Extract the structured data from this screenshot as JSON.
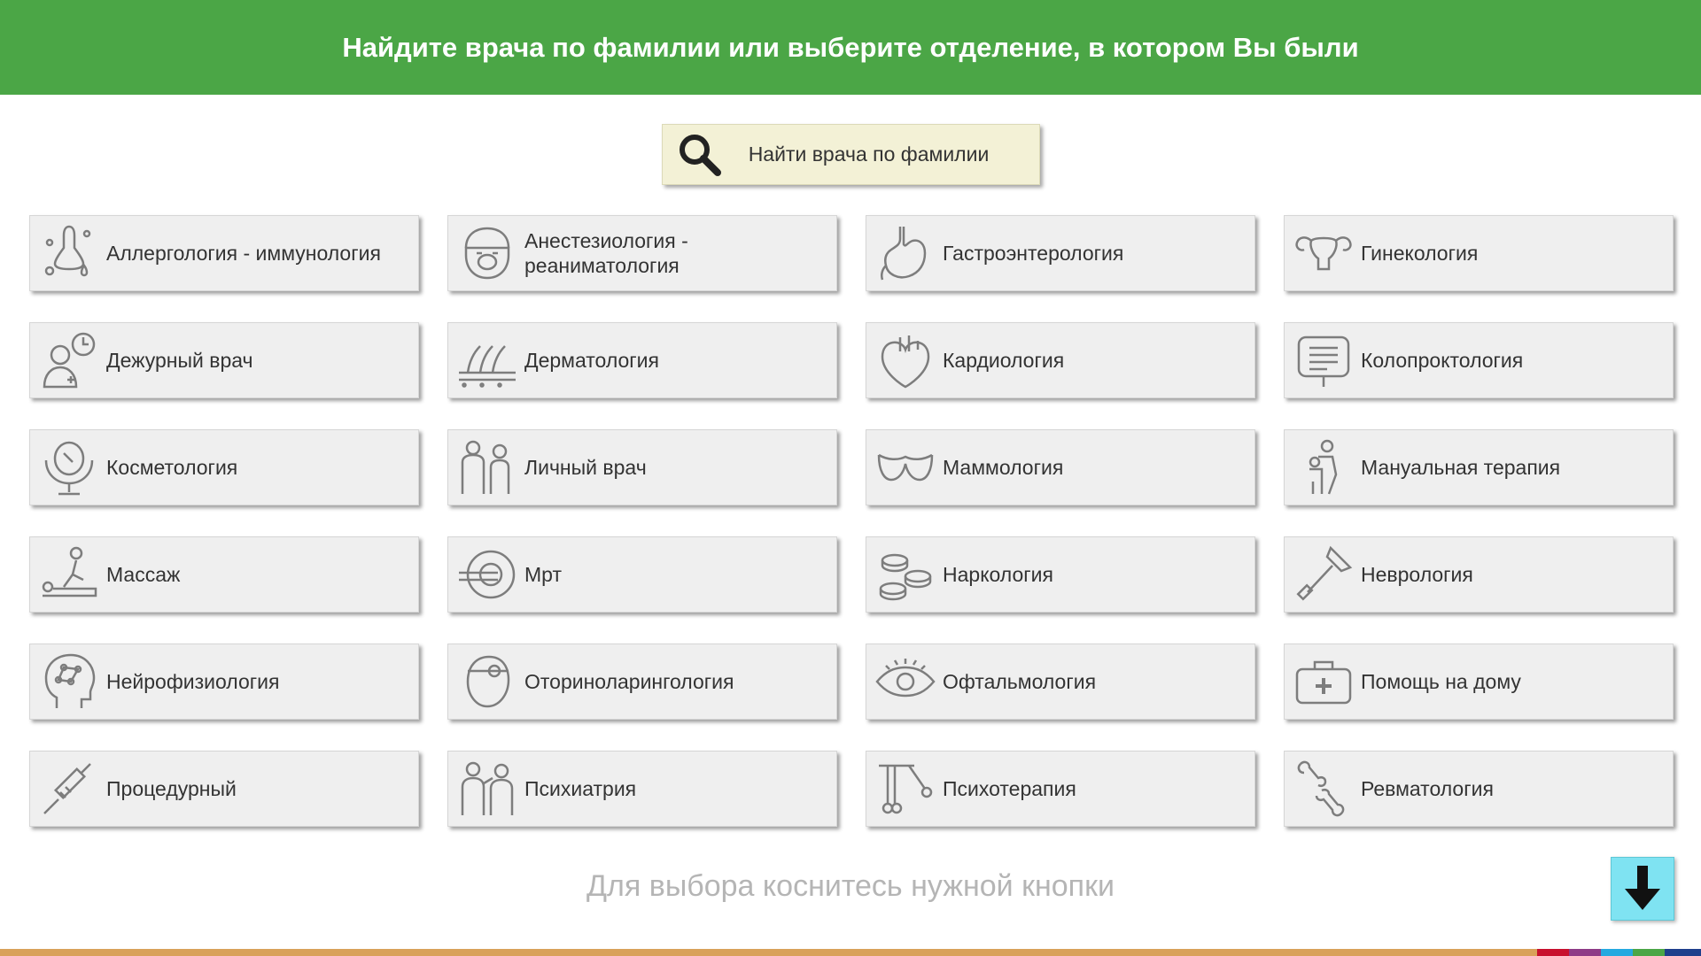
{
  "header": {
    "title": "Найдите врача по фамилии или выберите отделение, в котором Вы были"
  },
  "search": {
    "label": "Найти врача по фамилии",
    "icon": "search-icon"
  },
  "departments": [
    {
      "label": "Аллергология - иммунология",
      "icon": "allergy-icon"
    },
    {
      "label": "Анестезиология - реаниматология",
      "icon": "anesthesia-mask-icon"
    },
    {
      "label": "Гастроэнтерология",
      "icon": "stomach-icon"
    },
    {
      "label": "Гинекология",
      "icon": "uterus-icon"
    },
    {
      "label": "Дежурный врач",
      "icon": "doctor-clock-icon"
    },
    {
      "label": "Дерматология",
      "icon": "skin-hair-icon"
    },
    {
      "label": "Кардиология",
      "icon": "heart-icon"
    },
    {
      "label": "Колопроктология",
      "icon": "intestine-icon"
    },
    {
      "label": "Косметология",
      "icon": "mirror-icon"
    },
    {
      "label": "Личный врач",
      "icon": "doctor-patient-icon"
    },
    {
      "label": "Маммология",
      "icon": "breast-icon"
    },
    {
      "label": "Мануальная терапия",
      "icon": "manual-therapy-icon"
    },
    {
      "label": "Массаж",
      "icon": "massage-icon"
    },
    {
      "label": "Мрт",
      "icon": "mri-scanner-icon"
    },
    {
      "label": "Наркология",
      "icon": "pills-icon"
    },
    {
      "label": "Неврология",
      "icon": "reflex-hammer-icon"
    },
    {
      "label": "Нейрофизиология",
      "icon": "brain-head-icon"
    },
    {
      "label": "Оториноларингология",
      "icon": "ent-mirror-icon"
    },
    {
      "label": "Офтальмология",
      "icon": "eye-icon"
    },
    {
      "label": "Помощь на дому",
      "icon": "medical-bag-icon"
    },
    {
      "label": "Процедурный",
      "icon": "syringe-icon"
    },
    {
      "label": "Психиатрия",
      "icon": "psychiatrist-icon"
    },
    {
      "label": "Психотерапия",
      "icon": "pendulum-icon"
    },
    {
      "label": "Ревматология",
      "icon": "joint-bone-icon"
    }
  ],
  "hint": "Для выбора коснитесь нужной кнопки",
  "scroll": {
    "icon": "arrow-down-icon"
  },
  "colors": {
    "header_bg": "#4ba646",
    "search_bg": "#f3f1d6",
    "tile_bg": "#efefef",
    "icon_stroke": "#7d7d7d",
    "scroll_bg": "#7fe3f2",
    "bottom_bar": [
      "#d9a15a",
      "#c8102e",
      "#8e3b87",
      "#25a9e0",
      "#4ba646",
      "#1e3f8c"
    ]
  }
}
